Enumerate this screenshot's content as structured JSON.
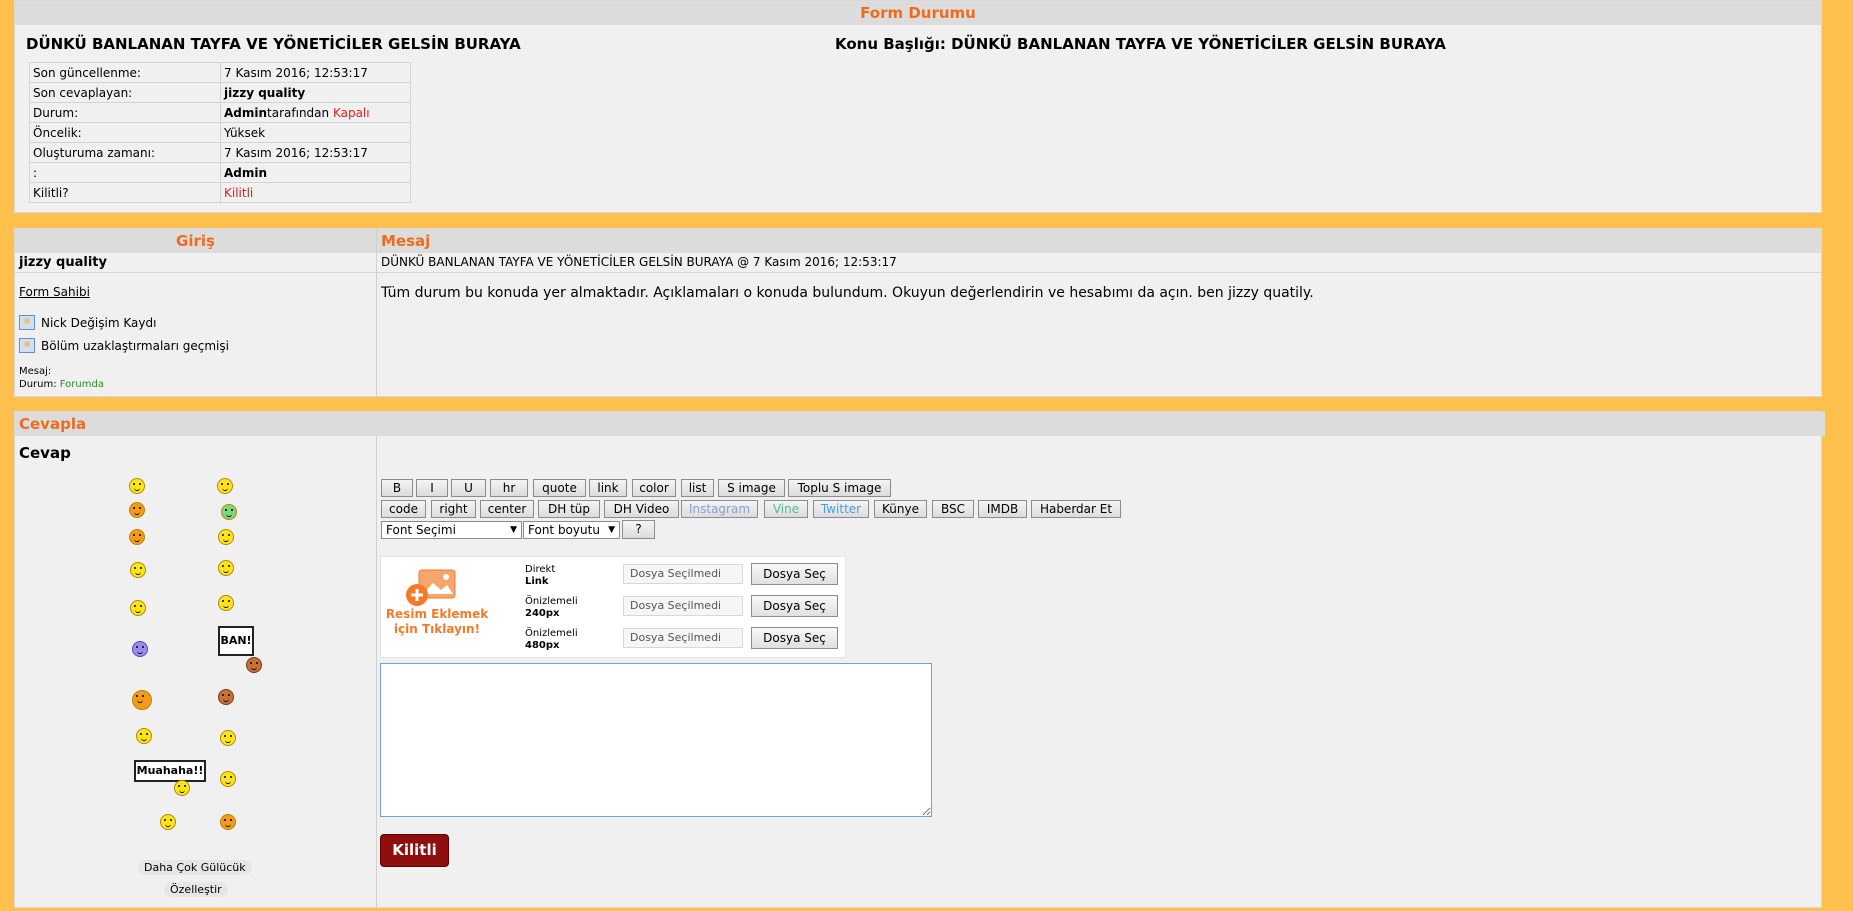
{
  "status_panel": {
    "title": "Form Durumu",
    "thread_title": "DÜNKÜ BANLANAN TAYFA VE YÖNETİCİLER GELSİN BURAYA",
    "topic_label": "Konu Başlığı: DÜNKÜ BANLANAN TAYFA VE YÖNETİCİLER GELSİN BURAYA",
    "rows": [
      {
        "label": "Son güncellenme:",
        "value": "7 Kasım 2016; 12:53:17"
      },
      {
        "label": "Son cevaplayan:",
        "value": "jizzy quality"
      },
      {
        "label": "Durum:",
        "value_bold": "Admin",
        "value_mid": "tarafından ",
        "value_red": "Kapalı"
      },
      {
        "label": "Öncelik:",
        "value": "Yüksek"
      },
      {
        "label": "Oluşturuma zamanı:",
        "value": "7 Kasım 2016; 12:53:17"
      },
      {
        "label": ":",
        "value": "Admin"
      },
      {
        "label": "Kilitli?",
        "value": "Kilitli"
      }
    ]
  },
  "post_panel": {
    "login_header": "Giriş",
    "message_header": "Mesaj",
    "username": "jizzy quality",
    "post_meta": "DÜNKÜ BANLANAN TAYFA VE YÖNETİCİLER GELSİN BURAYA @ 7 Kasım 2016; 12:53:17",
    "owner_link": "Form Sahibi",
    "nick_history": "Nick Değişim Kaydı",
    "ban_history": "Bölüm uzaklaştırmaları geçmişi",
    "msg_label": "Mesaj:",
    "status_label": "Durum: ",
    "status_value": "Forumda",
    "body": "Tüm durum bu konuda yer almaktadır. Açıklamaları o konuda bulundum. Okuyun değerlendirin ve hesabımı da açın. ben jizzy quatily."
  },
  "reply_panel": {
    "header": "Cevapla",
    "cevap_label": "Cevap",
    "smiley_banner_ban": "BAN!",
    "smiley_banner_muahaha": "Muahaha!!",
    "more_smileys": "Daha Çok Gülücük",
    "customize": "Özelleştir",
    "toolbar_row1": [
      "B",
      "I",
      "U",
      "hr",
      "quote",
      "link",
      "color",
      "list",
      "S image",
      "Toplu S image"
    ],
    "toolbar_row2": [
      "code",
      "right",
      "center",
      "DH tüp",
      "DH Video",
      "Instagram",
      "Vine",
      "Twitter",
      "Künye",
      "BSC",
      "IMDB",
      "Haberdar Et"
    ],
    "font_select": "Font Seçimi",
    "size_select": "Font boyutu",
    "help_btn": "?",
    "upload": {
      "promo": "Resim Eklemek için Tıklayın!",
      "options": [
        {
          "line1": "Direkt",
          "line2": "Link",
          "file": "Dosya Seçilmedi",
          "button": "Dosya Seç"
        },
        {
          "line1": "Önizlemeli",
          "line2": "240px",
          "file": "Dosya Seçilmedi",
          "button": "Dosya Seç"
        },
        {
          "line1": "Önizlemeli",
          "line2": "480px",
          "file": "Dosya Seçilmedi",
          "button": "Dosya Seç"
        }
      ]
    },
    "reply_text": "",
    "submit": "Kilitli"
  },
  "colors": {
    "accent": "#ef6c1f",
    "page_bg": "#ffc04d",
    "panel_bg": "#f0f0f0",
    "submit_bg": "#8f0f0f"
  }
}
